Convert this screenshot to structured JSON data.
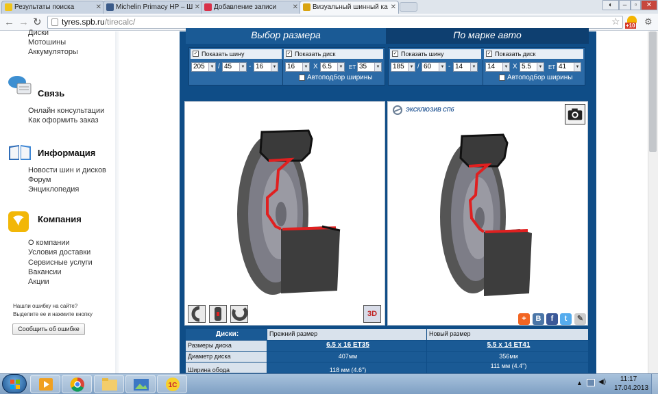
{
  "browser": {
    "tabs": [
      {
        "label": "Результаты поиска",
        "favicon_color": "#f0c419"
      },
      {
        "label": "Michelin Primacy HP – Ш",
        "favicon_color": "#3b5b8a"
      },
      {
        "label": "Добавление записи",
        "favicon_color": "#d8314a"
      },
      {
        "label": "Визуальный шинный ка",
        "favicon_color": "#d9a411"
      }
    ],
    "address": "tyres.spb.ru/tirecalc/",
    "address_host": "tyres.spb.ru",
    "address_path": "/tirecalc/",
    "extension_badge": "+10",
    "star_icon": "star-icon",
    "menu_icon": "wrench-icon"
  },
  "sidebar": {
    "top_links": [
      "Диски",
      "Мотошины",
      "Аккумуляторы"
    ],
    "sections": [
      {
        "title": "Связь",
        "icon": "chat-bubbles-icon",
        "links": [
          "Онлайн консультации",
          "Как оформить заказ"
        ]
      },
      {
        "title": "Информация",
        "icon": "book-icon",
        "links": [
          "Новости шин и дисков",
          "Форум",
          "Энциклопедия"
        ]
      },
      {
        "title": "Компания",
        "icon": "company-logo-icon",
        "links": [
          "О компании",
          "Условия доставки",
          "Сервисные услуги",
          "Вакансии",
          "Акции"
        ]
      }
    ],
    "error_note_line1": "Нашли ошибку на сайте?",
    "error_note_line2": "Выделите ее и нажмите кнопку",
    "error_button": "Сообщить об ошибке"
  },
  "calculator": {
    "header_tabs": [
      "Выбор размера",
      "По марке авто"
    ],
    "show_tire_label": "Показать шину",
    "show_disk_label": "Показать диск",
    "autofit_label": "Автоподбор ширины",
    "separator_slash": "/",
    "separator_dash": "-",
    "separator_x": "X",
    "et_label": "ET",
    "left": {
      "tire_width": "205",
      "tire_profile": "45",
      "tire_radius": "16",
      "disk_diameter": "16",
      "disk_width": "6.5",
      "disk_et": "35"
    },
    "right": {
      "tire_width": "185",
      "tire_profile": "60",
      "tire_radius": "14",
      "disk_diameter": "14",
      "disk_width": "5.5",
      "disk_et": "41"
    },
    "brand_logo_text": "ЭКСКЛЮЗИВ СПб",
    "badge_3d": "3D"
  },
  "disk_table": {
    "header": "Диски:",
    "col_old": "Прежний размер",
    "col_new": "Новый размер",
    "rows": [
      {
        "label": "Размеры диска",
        "old": "6.5 x 16 ET35",
        "new": "5.5 x 14 ET41"
      },
      {
        "label": "Диаметр диска",
        "old": "407мм",
        "new": "356мм"
      },
      {
        "label": "Ширина обода",
        "old": "118 мм (4.6\")",
        "new": "111 мм (4.4\")"
      }
    ]
  },
  "taskbar": {
    "time": "11:17",
    "date": "17.04.2013"
  },
  "colors": {
    "page_blue": "#0f4d87",
    "panel_blue": "#2b6aa6",
    "tire_red": "#e02020"
  }
}
